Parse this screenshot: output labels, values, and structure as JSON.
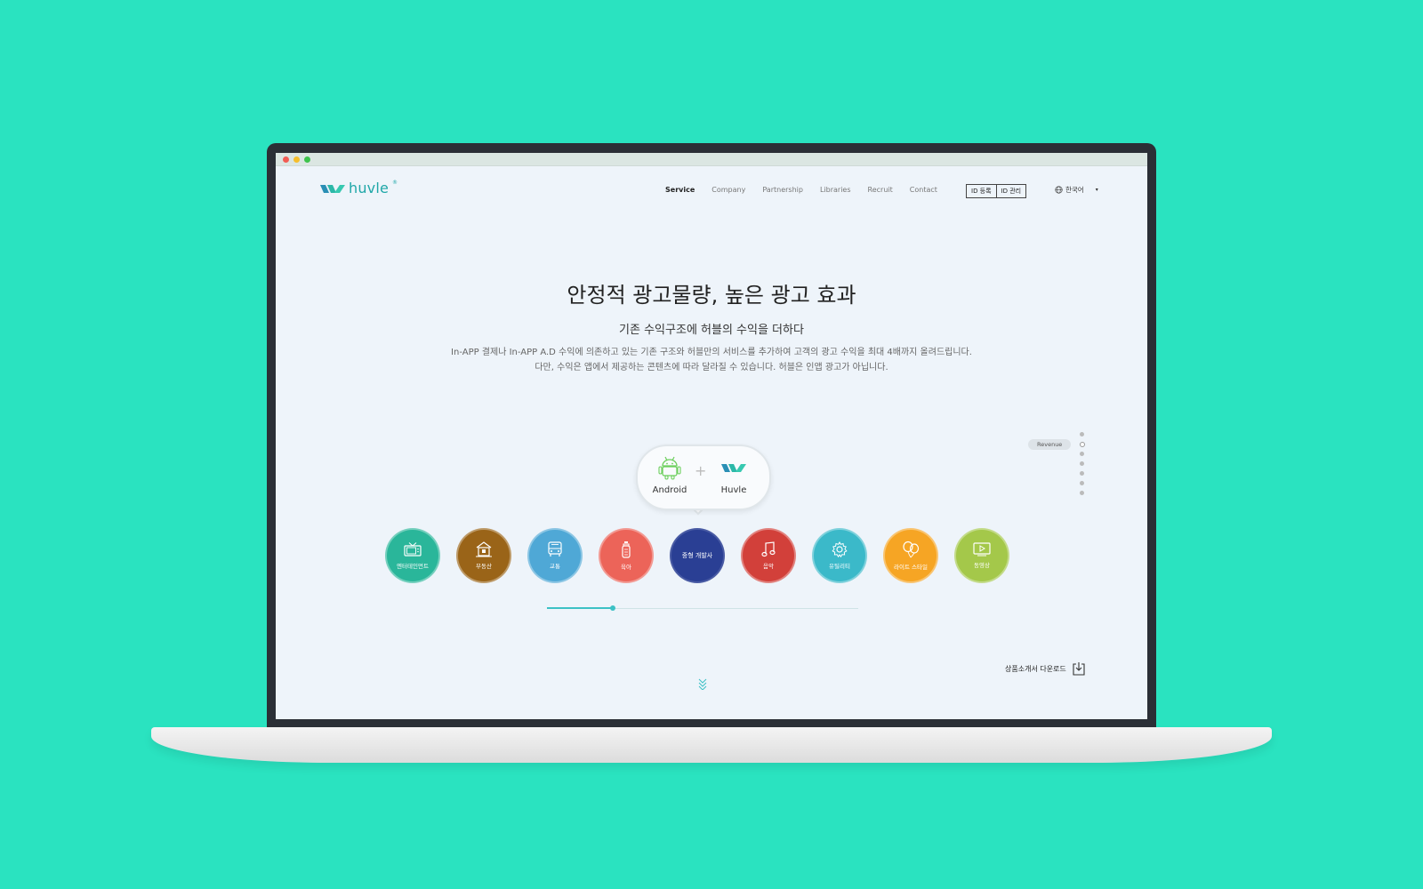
{
  "brand": {
    "name": "huvle",
    "reg_mark": "®",
    "accent": "#1fa7a8"
  },
  "nav": {
    "items": [
      {
        "label": "Service",
        "active": true
      },
      {
        "label": "Company",
        "active": false
      },
      {
        "label": "Partnership",
        "active": false
      },
      {
        "label": "Libraries",
        "active": false
      },
      {
        "label": "Recruit",
        "active": false
      },
      {
        "label": "Contact",
        "active": false
      }
    ],
    "id_register": "ID 등록",
    "id_manage": "ID 관리",
    "language": "한국어"
  },
  "hero": {
    "title": "안정적 광고물량, 높은 광고 효과",
    "subtitle": "기존 수익구조에 허블의 수익을 더하다",
    "desc_line1": "In-APP 결제나 In-APP A.D 수익에 의존하고 있는 기존 구조와 허블만의 서비스를 추가하여 고객의 광고 수익을 최대 4배까지 올려드립니다.",
    "desc_line2": "다만, 수익은 앱에서 제공하는 콘텐츠에  따라 달라질 수 있습니다. 허블은 인앱 광고가 아닙니다."
  },
  "side_nav": {
    "active_label": "Revenue",
    "dot_count": 7,
    "active_index": 1
  },
  "bubble": {
    "left_label": "Android",
    "plus": "+",
    "right_label": "Huvle"
  },
  "categories": [
    {
      "label": "엔터테인먼트",
      "color": "#2ab69a",
      "icon": "tv-icon"
    },
    {
      "label": "부동산",
      "color": "#9a6418",
      "icon": "house-icon"
    },
    {
      "label": "교통",
      "color": "#4fa8d6",
      "icon": "bus-icon"
    },
    {
      "label": "육아",
      "color": "#ec6459",
      "icon": "bottle-icon"
    },
    {
      "label": "중형 개발사",
      "color": "#2a3f94",
      "icon": ""
    },
    {
      "label": "음악",
      "color": "#d2403a",
      "icon": "music-icon"
    },
    {
      "label": "유틸리티",
      "color": "#3bb9c9",
      "icon": "gear-icon"
    },
    {
      "label": "라이트 스타일",
      "color": "#f6a524",
      "icon": "balloon-icon"
    },
    {
      "label": "동영상",
      "color": "#a4c84a",
      "icon": "video-icon"
    }
  ],
  "slider": {
    "progress": 0.22
  },
  "download": {
    "label": "상품소개서 다운로드"
  }
}
